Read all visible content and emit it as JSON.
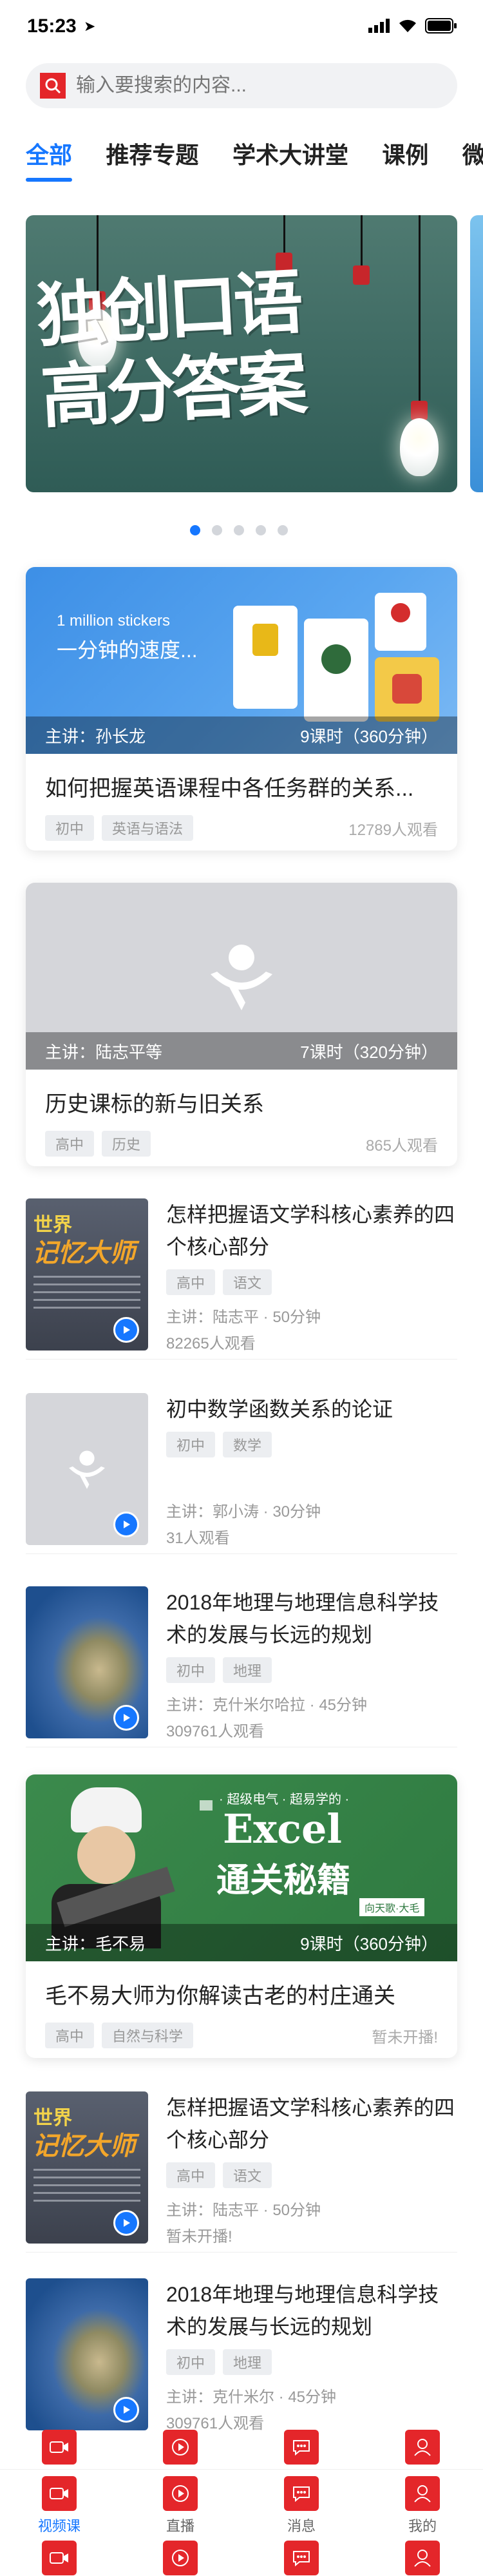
{
  "status": {
    "time": "15:23"
  },
  "search": {
    "placeholder": "输入要搜索的内容..."
  },
  "tabs": [
    "全部",
    "推荐专题",
    "学术大讲堂",
    "课例",
    "微"
  ],
  "banner": {
    "text_line1": "独创口语",
    "text_line2": "高分答案"
  },
  "featured": [
    {
      "overlay_line1": "1 million stickers",
      "overlay_line2": "一分钟的速度...",
      "lecturer": "主讲：孙长龙",
      "hours": "9课时（360分钟）",
      "title": "如何把握英语课程中各任务群的关系...",
      "tags": [
        "初中",
        "英语与语法"
      ],
      "views": "12789人观看"
    },
    {
      "lecturer": "主讲：陆志平等",
      "hours": "7课时（320分钟）",
      "title": "历史课标的新与旧关系",
      "tags": [
        "高中",
        "历史"
      ],
      "views": "865人观看"
    }
  ],
  "list": [
    {
      "title": "怎样把握语文学科核心素养的四个核心部分",
      "tags": [
        "高中",
        "语文"
      ],
      "lecturer": "主讲：陆志平",
      "duration": "50分钟",
      "views": "82265人观看",
      "thumb_text1": "世界",
      "thumb_text2": "记忆大师"
    },
    {
      "title": "初中数学函数关系的论证",
      "tags": [
        "初中",
        "数学"
      ],
      "lecturer": "主讲：郭小涛",
      "duration": "30分钟",
      "views": "31人观看"
    },
    {
      "title": "2018年地理与地理信息科学技术的发展与长远的规划",
      "tags": [
        "初中",
        "地理"
      ],
      "lecturer": "主讲：克什米尔哈拉",
      "duration": "45分钟",
      "views": "309761人观看"
    }
  ],
  "featured3": {
    "banner_small": "· 超级电气 · 超易学的 ·",
    "banner_big1": "Excel",
    "banner_big2": "通关秘籍",
    "banner_sign": "向天歌·大毛",
    "lecturer": "主讲：毛不易",
    "hours": "9课时（360分钟）",
    "title": "毛不易大师为你解读古老的村庄通关",
    "tags": [
      "高中",
      "自然与科学"
    ],
    "views": "暂未开播!"
  },
  "list2": [
    {
      "title": "怎样把握语文学科核心素养的四个核心部分",
      "tags": [
        "高中",
        "语文"
      ],
      "lecturer": "主讲：陆志平",
      "duration": "50分钟",
      "views": "暂未开播!",
      "thumb_text1": "世界",
      "thumb_text2": "记忆大师"
    },
    {
      "title": "2018年地理与地理信息科学技术的发展与长远的规划",
      "tags": [
        "初中",
        "地理"
      ],
      "lecturer": "主讲：克什米尔",
      "duration": "45分钟",
      "views": "309761人观看"
    }
  ],
  "tabbar": [
    "视频课",
    "直播",
    "消息",
    "我的"
  ],
  "colors": {
    "accent": "#1677ff",
    "brand_red": "#e4262a"
  }
}
